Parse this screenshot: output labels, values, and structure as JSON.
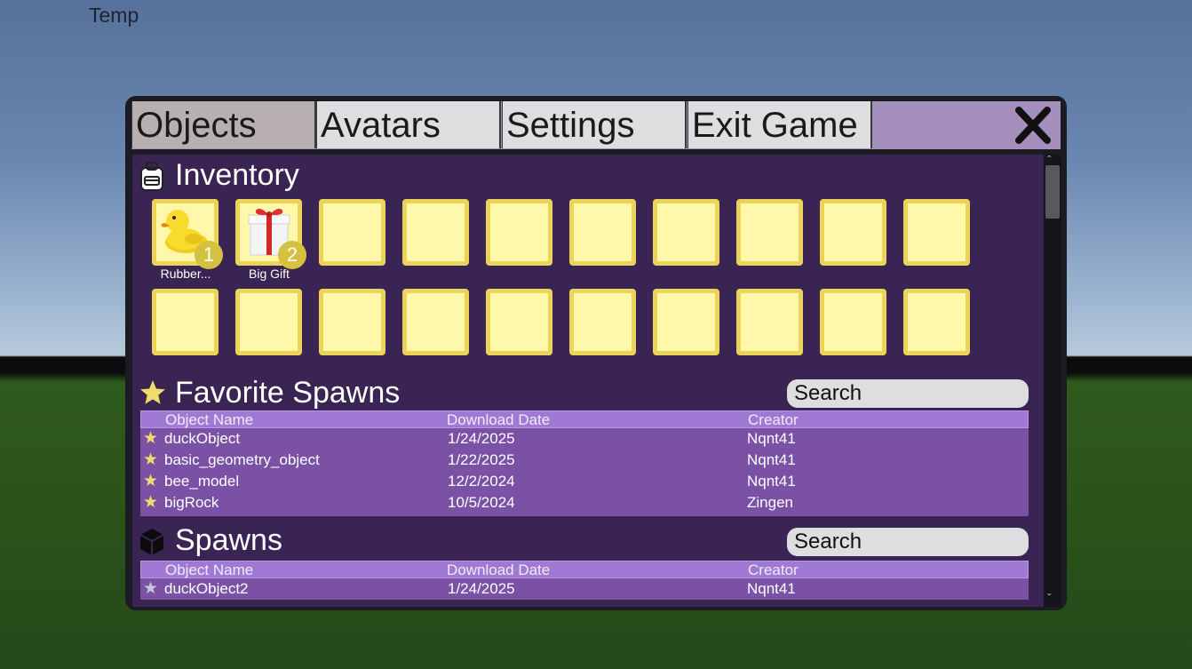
{
  "hud": {
    "temp_label": "Temp"
  },
  "tabs": [
    {
      "label": "Objects",
      "active": true
    },
    {
      "label": "Avatars",
      "active": false
    },
    {
      "label": "Settings",
      "active": false
    },
    {
      "label": "Exit Game",
      "active": false
    }
  ],
  "close_icon": "close-x-icon",
  "inventory": {
    "title": "Inventory",
    "icon": "backpack-icon",
    "items": [
      {
        "label": "Rubber...",
        "count": "1",
        "icon": "rubber-duck-icon"
      },
      {
        "label": "Big Gift",
        "count": "2",
        "icon": "gift-box-icon"
      }
    ]
  },
  "favorites": {
    "title": "Favorite Spawns",
    "icon": "star-icon",
    "search_placeholder": "Search",
    "columns": [
      "Object Name",
      "Download Date",
      "Creator"
    ],
    "rows": [
      {
        "name": "duckObject",
        "date": "1/24/2025",
        "creator": "Nqnt41",
        "favorited": true
      },
      {
        "name": "basic_geometry_object",
        "date": "1/22/2025",
        "creator": "Nqnt41",
        "favorited": true
      },
      {
        "name": "bee_model",
        "date": "12/2/2024",
        "creator": "Nqnt41",
        "favorited": true
      },
      {
        "name": "bigRock",
        "date": "10/5/2024",
        "creator": "Zingen",
        "favorited": true
      }
    ]
  },
  "spawns": {
    "title": "Spawns",
    "icon": "cube-icon",
    "search_placeholder": "Search",
    "columns": [
      "Object Name",
      "Download Date",
      "Creator"
    ],
    "rows": [
      {
        "name": "duckObject2",
        "date": "1/24/2025",
        "creator": "Nqnt41",
        "favorited": false
      }
    ]
  },
  "colors": {
    "panel_bg": "#3a2453",
    "slot_fill": "#fff8ab",
    "slot_border": "#ecd45a",
    "star_active": "#f0dc6a",
    "star_inactive": "#c8c8d8"
  }
}
